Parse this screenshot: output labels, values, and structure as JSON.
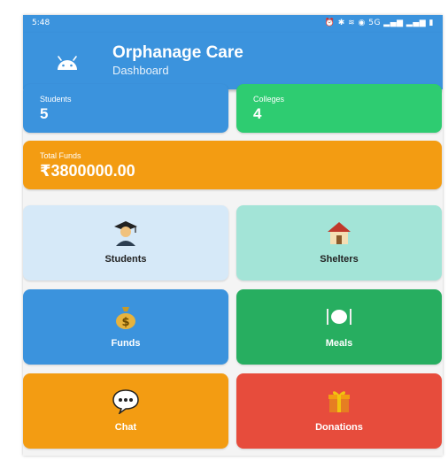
{
  "status_bar": {
    "time": "5:48",
    "right_indicators": "⏰ ✱ ≋ ◉ 5G ▂▄▆ ▂▄▆ ▮"
  },
  "app_bar": {
    "title": "Orphanage Care",
    "subtitle": "Dashboard",
    "logo_icon": "android-icon"
  },
  "stats": {
    "students": {
      "label": "Students",
      "value": "5",
      "color": "#3b93dd"
    },
    "colleges": {
      "label": "Colleges",
      "value": "4",
      "color": "#2ecc71"
    },
    "funds": {
      "label": "Total Funds",
      "value": "₹3800000.00",
      "color": "#f39c12"
    }
  },
  "tiles": [
    {
      "label": "Students",
      "icon": "student-graduate-icon",
      "bg": "#d6e9f8",
      "fg": "#222222"
    },
    {
      "label": "Shelters",
      "icon": "house-icon",
      "bg": "#a3e4d7",
      "fg": "#222222"
    },
    {
      "label": "Funds",
      "icon": "money-bag-icon",
      "bg": "#3b93dd",
      "fg": "#ffffff"
    },
    {
      "label": "Meals",
      "icon": "plate-cutlery-icon",
      "bg": "#27ae60",
      "fg": "#ffffff"
    },
    {
      "label": "Chat",
      "icon": "speech-bubble-icon",
      "bg": "#f39c12",
      "fg": "#ffffff"
    },
    {
      "label": "Donations",
      "icon": "gift-icon",
      "bg": "#e74c3c",
      "fg": "#ffffff"
    }
  ]
}
